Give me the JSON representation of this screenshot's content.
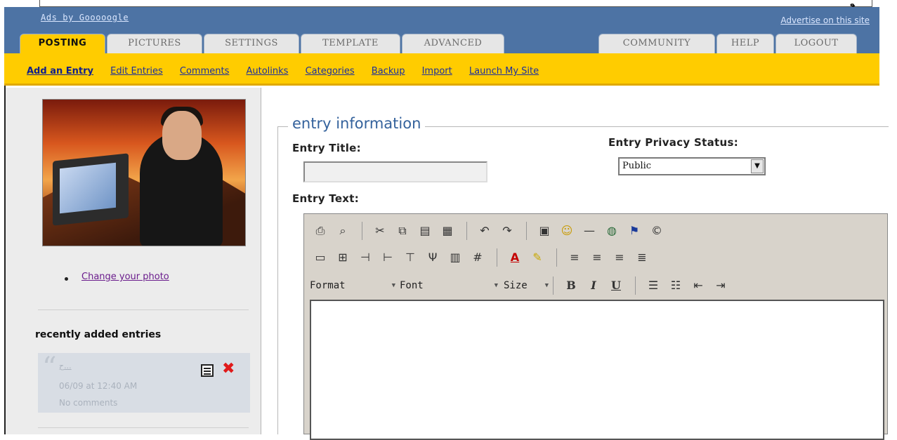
{
  "top": {
    "arrow": "ﻮ"
  },
  "ads": {
    "left": "Ads by Gooooogle",
    "right": "Advertise on this site"
  },
  "tabs": [
    {
      "label": "POSTING",
      "active": true
    },
    {
      "label": "PICTURES",
      "active": false
    },
    {
      "label": "SETTINGS",
      "active": false
    },
    {
      "label": "TEMPLATE",
      "active": false
    },
    {
      "label": "ADVANCED",
      "active": false
    },
    {
      "label": "COMMUNITY",
      "active": false
    },
    {
      "label": "HELP",
      "active": false
    },
    {
      "label": "LOGOUT",
      "active": false
    }
  ],
  "subnav": [
    "Add an Entry",
    "Edit Entries",
    "Comments",
    "Autolinks",
    "Categories",
    "Backup",
    "Import",
    "Launch My Site"
  ],
  "sidebar": {
    "change_photo": "Change your photo",
    "recent_title": "recently added entries",
    "entry": {
      "title": "ح...",
      "date": "06/09 at 12:40 AM",
      "comments": "No comments"
    }
  },
  "form": {
    "legend": "entry information",
    "title_label": "Entry Title:",
    "title_value": "",
    "privacy_label": "Entry Privacy Status:",
    "privacy_value": "Public",
    "text_label": "Entry Text:"
  },
  "editor": {
    "format_label": "Format",
    "font_label": "Font",
    "size_label": "Size",
    "bold_label": "B",
    "italic_label": "I",
    "underline_label": "U"
  },
  "colors": {
    "nav_blue": "#4d73a4",
    "nav_yellow": "#ffcc00",
    "legend_blue": "#34629c"
  }
}
